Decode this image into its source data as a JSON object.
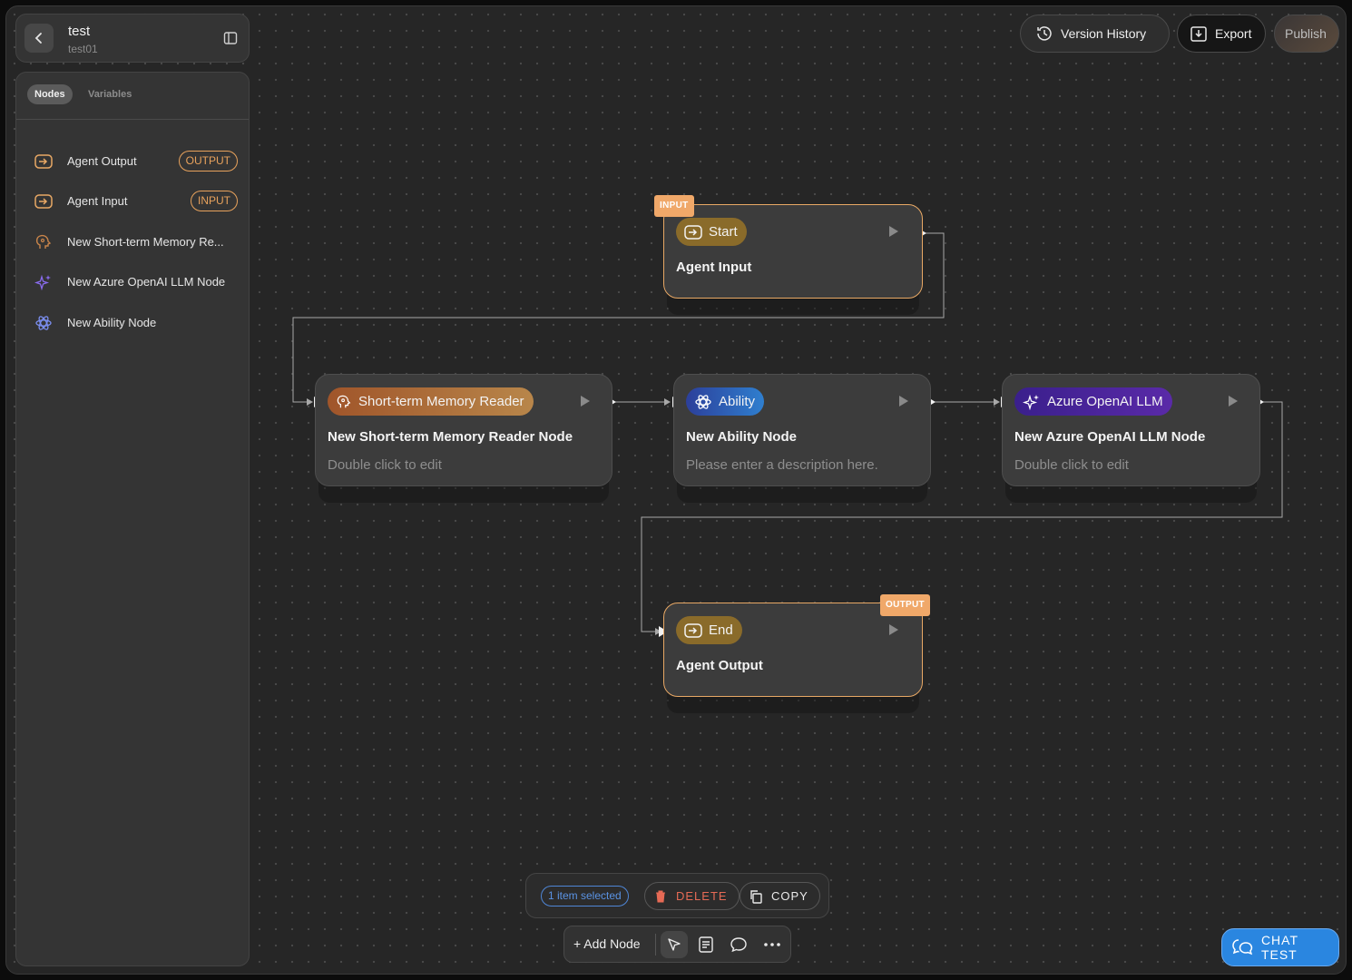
{
  "header": {
    "title": "test",
    "subtitle": "test01"
  },
  "sidebar": {
    "tabs": [
      {
        "label": "Nodes",
        "active": true
      },
      {
        "label": "Variables",
        "active": false
      }
    ],
    "items": [
      {
        "label": "Agent Output",
        "badge": "OUTPUT",
        "icon": "io-icon"
      },
      {
        "label": "Agent Input",
        "badge": "INPUT",
        "icon": "io-icon"
      },
      {
        "label": "New Short-term Memory Re...",
        "icon": "memory-icon"
      },
      {
        "label": "New Azure OpenAI LLM Node",
        "icon": "sparkle-icon"
      },
      {
        "label": "New Ability Node",
        "icon": "ability-icon"
      }
    ]
  },
  "toolbar": {
    "version_history": "Version History",
    "export": "Export",
    "publish": "Publish"
  },
  "nodes": {
    "start": {
      "tag": "INPUT",
      "pill": "Start",
      "title": "Agent Input"
    },
    "memory": {
      "pill": "Short-term Memory Reader",
      "title": "New Short-term Memory Reader Node",
      "desc": "Double click to edit"
    },
    "ability": {
      "pill": "Ability",
      "title": "New Ability Node",
      "desc": "Please enter a description here."
    },
    "llm": {
      "pill": "Azure OpenAI LLM",
      "title": "New Azure OpenAI LLM Node",
      "desc": "Double click to edit"
    },
    "end": {
      "tag": "OUTPUT",
      "pill": "End",
      "title": "Agent Output"
    }
  },
  "selection": {
    "count_label": "1 item selected",
    "delete_label": "DELETE",
    "copy_label": "COPY"
  },
  "bottom_toolbar": {
    "add_node": "+ Add Node"
  },
  "chat_test": {
    "label": "CHAT TEST"
  },
  "colors": {
    "accent_orange": "#e8a865",
    "accent_blue": "#2a86e0",
    "delete_red": "#e66a55"
  }
}
